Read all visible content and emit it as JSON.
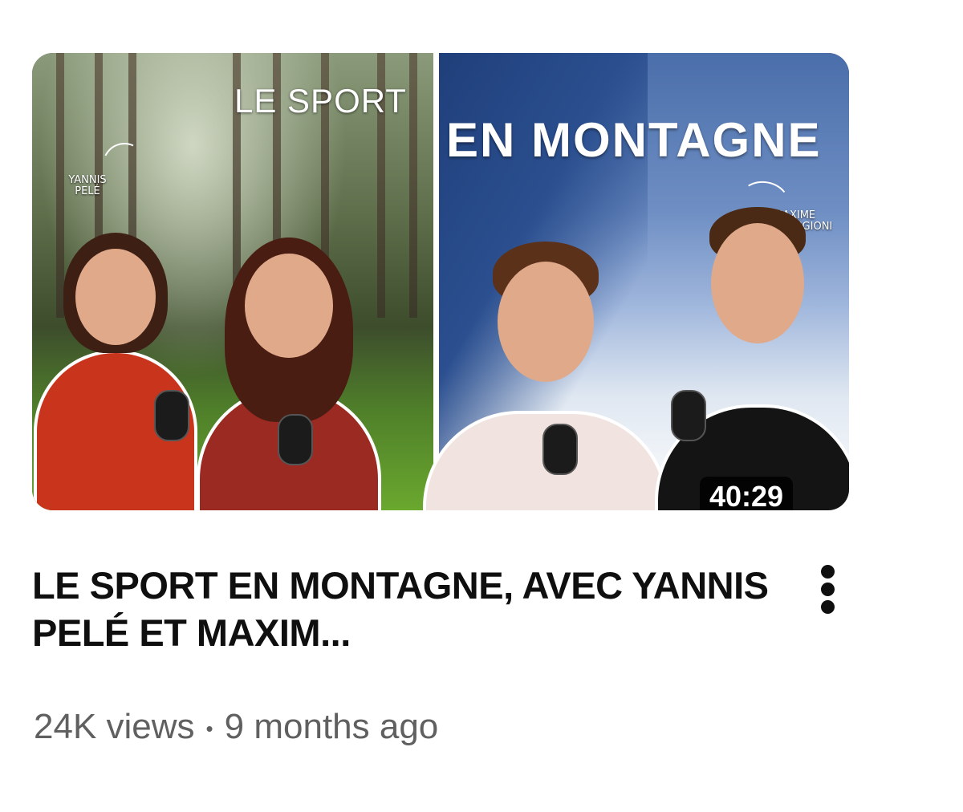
{
  "video": {
    "thumbnail": {
      "text_left": "LE SPORT",
      "text_right": "EN MONTAGNE",
      "name_left": "YANNIS\nPELÉ",
      "name_right": "MAXIME\nMONTAGGIONI",
      "duration": "40:29"
    },
    "title": "LE SPORT EN MONTAGNE, AVEC YANNIS PELÉ ET MAXIM...",
    "views": "24K views",
    "separator": "•",
    "age": "9 months ago",
    "more_icon": "more-vert-icon"
  }
}
